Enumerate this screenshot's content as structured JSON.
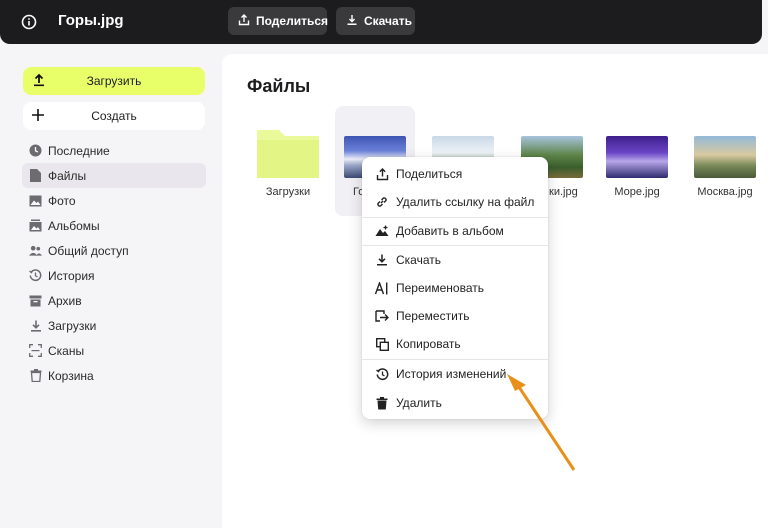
{
  "header": {
    "file_title": "Горы.jpg",
    "share_label": "Поделиться",
    "download_label": "Скачать",
    "icons": {
      "info": "info-icon",
      "share": "share-icon",
      "download": "download-icon"
    }
  },
  "sidebar": {
    "upload_label": "Загрузить",
    "create_label": "Создать",
    "items": [
      {
        "label": "Последние",
        "icon": "clock-icon"
      },
      {
        "label": "Файлы",
        "icon": "file-icon",
        "active": true
      },
      {
        "label": "Фото",
        "icon": "photo-icon"
      },
      {
        "label": "Альбомы",
        "icon": "albums-icon"
      },
      {
        "label": "Общий доступ",
        "icon": "shared-icon"
      },
      {
        "label": "История",
        "icon": "history-icon"
      },
      {
        "label": "Архив",
        "icon": "archive-icon"
      },
      {
        "label": "Загрузки",
        "icon": "downloads-icon"
      },
      {
        "label": "Сканы",
        "icon": "scan-icon"
      },
      {
        "label": "Корзина",
        "icon": "trash-icon"
      }
    ]
  },
  "main": {
    "title": "Файлы",
    "files": [
      {
        "name": "Загрузки",
        "type": "folder"
      },
      {
        "name": "Го",
        "type": "image",
        "selected": true
      },
      {
        "name": "",
        "type": "image"
      },
      {
        "name": "ки.jpg",
        "type": "image"
      },
      {
        "name": "Море.jpg",
        "type": "image"
      },
      {
        "name": "Москва.jpg",
        "type": "image"
      }
    ]
  },
  "context_menu": {
    "items": [
      {
        "label": "Поделиться",
        "icon": "share-icon"
      },
      {
        "label": "Удалить ссылку на файл",
        "icon": "link-icon"
      },
      {
        "label": "Добавить в альбом",
        "icon": "add-to-album-icon"
      },
      {
        "label": "Скачать",
        "icon": "download-icon"
      },
      {
        "label": "Переименовать",
        "icon": "rename-icon"
      },
      {
        "label": "Переместить",
        "icon": "move-icon"
      },
      {
        "label": "Копировать",
        "icon": "copy-icon"
      },
      {
        "label": "История изменений",
        "icon": "history-icon"
      },
      {
        "label": "Удалить",
        "icon": "trash-icon"
      }
    ]
  },
  "colors": {
    "accent": "#e9ff6a",
    "topbar": "#1c1c1e",
    "annotation_arrow": "#e8901a"
  }
}
